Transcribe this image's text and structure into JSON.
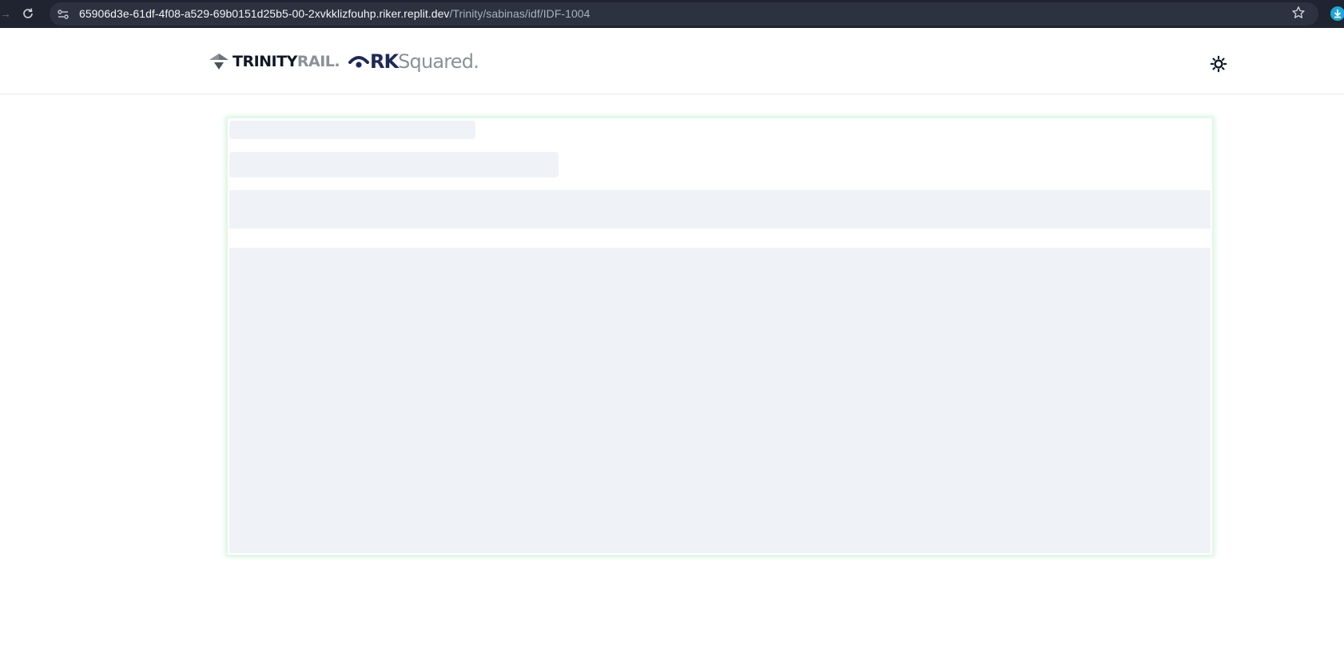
{
  "browser": {
    "url_host": "65906d3e-61df-4f08-a529-69b0151d25b5-00-2xvkklizfouhp.riker.replit.dev",
    "url_path": "/Trinity/sabinas/idf/IDF-1004"
  },
  "header": {
    "trinity_logo_main": "TRINITY",
    "trinity_logo_accent": "RAIL",
    "trinity_logo_dot": ".",
    "rk_logo_main": "RK",
    "rk_logo_accent": "Squared",
    "rk_logo_dot": "."
  },
  "icons": {
    "back": "arrow-back-icon",
    "reload": "reload-icon",
    "site_info": "site-settings-icon",
    "bookmark": "star-icon",
    "download": "download-icon",
    "theme": "sun-icon"
  },
  "colors": {
    "chrome_bg": "#1f2430",
    "omnibox_bg": "#2c3240",
    "skeleton": "#eff2f6",
    "card_glow": "#d6f5db",
    "brand_navy": "#1e2a55",
    "brand_gray": "#8a9199"
  }
}
